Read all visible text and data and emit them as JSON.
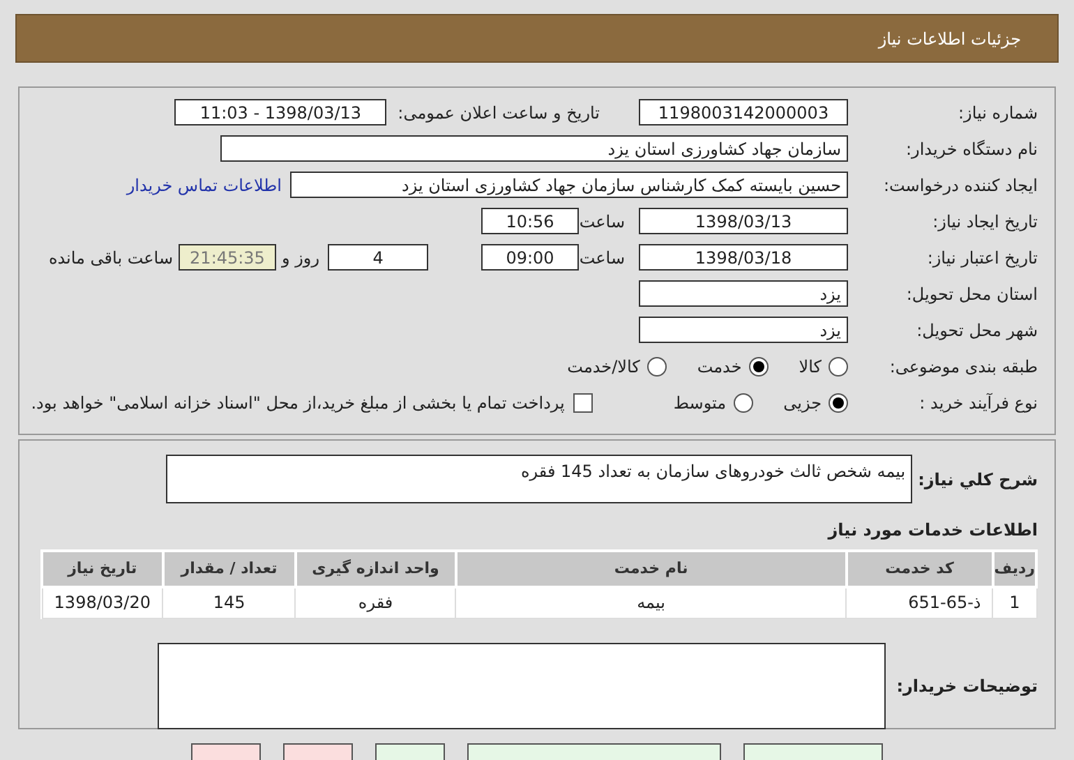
{
  "header": {
    "title": "جزئیات اطلاعات نیاز"
  },
  "need_number": {
    "label": "شماره نیاز:",
    "value": "1198003142000003"
  },
  "announce": {
    "label": "تاریخ و ساعت اعلان عمومی:",
    "value": "1398/03/13 - 11:03"
  },
  "buyer_org": {
    "label": "نام دستگاه خریدار:",
    "value": "سازمان جهاد کشاورزی استان یزد"
  },
  "requester": {
    "label": "ایجاد کننده درخواست:",
    "value": "حسین بایسته کمک کارشناس سازمان جهاد کشاورزی استان یزد",
    "link": "اطلاعات تماس خریدار"
  },
  "created": {
    "label": "تاریخ ایجاد نیاز:",
    "date": "1398/03/13",
    "time_label": "ساعت",
    "time": "10:56"
  },
  "validity": {
    "label": "تاریخ اعتبار نیاز:",
    "date": "1398/03/18",
    "time_label": "ساعت",
    "time": "09:00",
    "days": "4",
    "days_label": "روز و",
    "remaining": "21:45:35",
    "remaining_label": "ساعت باقی مانده"
  },
  "province": {
    "label": "استان محل تحویل:",
    "value": "یزد"
  },
  "city": {
    "label": "شهر محل تحویل:",
    "value": "یزد"
  },
  "category": {
    "label": "طبقه بندی موضوعی:",
    "options": [
      {
        "label": "کالا",
        "selected": false
      },
      {
        "label": "خدمت",
        "selected": true
      },
      {
        "label": "کالا/خدمت",
        "selected": false
      }
    ]
  },
  "process": {
    "label": "نوع فرآیند خرید :",
    "options": [
      {
        "label": "جزیی",
        "selected": true
      },
      {
        "label": "متوسط",
        "selected": false
      }
    ],
    "payment": {
      "label": "پرداخت تمام یا بخشی از مبلغ خرید،از محل \"اسناد خزانه اسلامی\" خواهد بود.",
      "checked": false
    }
  },
  "description": {
    "label": "شرح کلي نیاز:",
    "value": "بیمه شخص ثالث خودروهای سازمان به تعداد 145 فقره"
  },
  "services": {
    "title": "اطلاعات خدمات مورد نیاز",
    "columns": [
      "ردیف",
      "کد خدمت",
      "نام خدمت",
      "واحد اندازه گیری",
      "تعداد / مقدار",
      "تاریخ نیاز"
    ],
    "rows": [
      [
        "1",
        "ذ-65-651",
        "بیمه",
        "فقره",
        "145",
        "1398/03/20"
      ]
    ]
  },
  "buyer_notes": {
    "label": "توضیحات خریدار:"
  },
  "buttons": [
    {
      "color": "#e6f7e6"
    },
    {
      "color": "#e6f7e6"
    },
    {
      "color": "#e6f7e6"
    },
    {
      "color": "#fbdede"
    },
    {
      "color": "#fbdede"
    }
  ]
}
